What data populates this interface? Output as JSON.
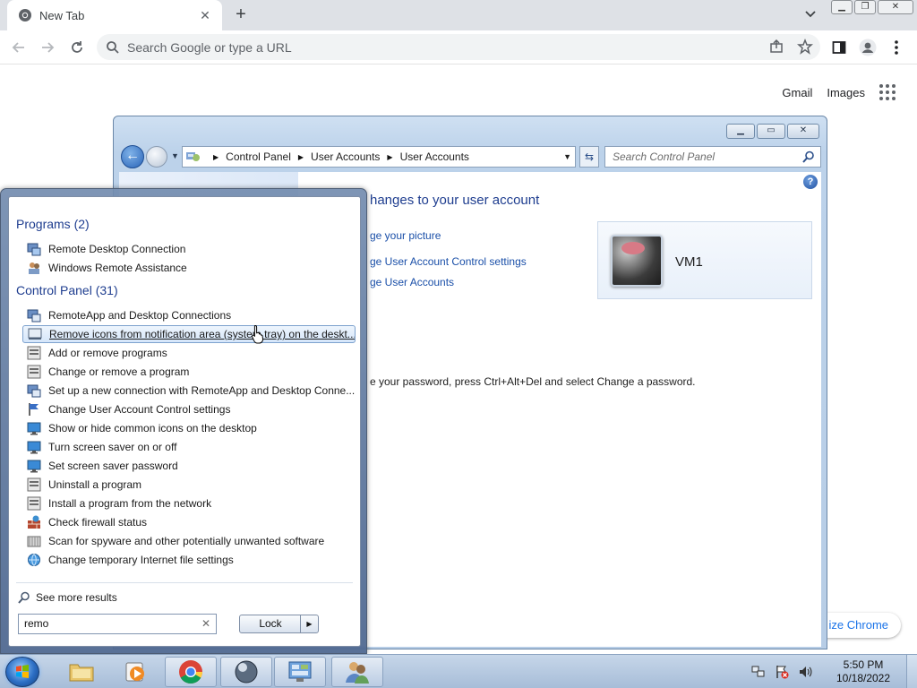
{
  "chrome": {
    "tab_title": "New Tab",
    "tab_close": "✕",
    "new_tab": "+",
    "omnibox_placeholder": "Search Google or type a URL",
    "gmail": "Gmail",
    "images": "Images",
    "customize": "ize Chrome"
  },
  "control_panel": {
    "breadcrumb": [
      "Control Panel",
      "User Accounts",
      "User Accounts"
    ],
    "search_placeholder": "Search Control Panel",
    "heading": "hanges to your user account",
    "links": [
      "ge your picture",
      "ge User Account Control settings",
      "ge User Accounts"
    ],
    "user_name": "VM1",
    "note": "e your password, press Ctrl+Alt+Del and select Change a password.",
    "help": "?"
  },
  "start_menu": {
    "programs_header": "Programs (2)",
    "programs": [
      {
        "label": "Remote Desktop Connection",
        "icon": "remote-desktop-icon"
      },
      {
        "label": "Windows Remote Assistance",
        "icon": "remote-assistance-icon"
      }
    ],
    "control_panel_header": "Control Panel (31)",
    "control_panel_items": [
      {
        "label": "RemoteApp and Desktop Connections",
        "icon": "remoteapp-icon"
      },
      {
        "label": "Remove icons from notification area (system tray) on the deskt...",
        "icon": "notification-area-icon",
        "highlight": true
      },
      {
        "label": "Add or remove programs",
        "icon": "programs-icon"
      },
      {
        "label": "Change or remove a program",
        "icon": "programs-icon"
      },
      {
        "label": "Set up a new connection with RemoteApp and Desktop Conne...",
        "icon": "remoteapp-icon"
      },
      {
        "label": "Change User Account Control settings",
        "icon": "uac-flag-icon"
      },
      {
        "label": "Show or hide common icons on the desktop",
        "icon": "display-icon"
      },
      {
        "label": "Turn screen saver on or off",
        "icon": "display-icon"
      },
      {
        "label": "Set screen saver password",
        "icon": "display-icon"
      },
      {
        "label": "Uninstall a program",
        "icon": "programs-icon"
      },
      {
        "label": "Install a program from the network",
        "icon": "programs-icon"
      },
      {
        "label": "Check firewall status",
        "icon": "firewall-icon"
      },
      {
        "label": "Scan for spyware and other potentially unwanted software",
        "icon": "defender-icon"
      },
      {
        "label": "Change temporary Internet file settings",
        "icon": "internet-options-icon"
      }
    ],
    "see_more": "See more results",
    "search_value": "remo",
    "search_clear": "✕",
    "lock_label": "Lock",
    "lock_arrow": "▶"
  },
  "taskbar": {
    "apps": [
      {
        "name": "explorer",
        "icon": "folder-icon"
      },
      {
        "name": "media-player",
        "icon": "media-player-icon"
      },
      {
        "name": "chrome",
        "icon": "chrome-icon",
        "active": true
      },
      {
        "name": "orb-app",
        "icon": "sphere-icon",
        "active": true
      },
      {
        "name": "control-panel",
        "icon": "control-panel-icon",
        "active": true
      },
      {
        "name": "users-app",
        "icon": "users-icon",
        "active": true
      }
    ],
    "time": "5:50 PM",
    "date": "10/18/2022"
  },
  "colors": {
    "link": "#1a4fa8",
    "heading": "#1e3d8f",
    "taskbar": "#b3c7df"
  }
}
